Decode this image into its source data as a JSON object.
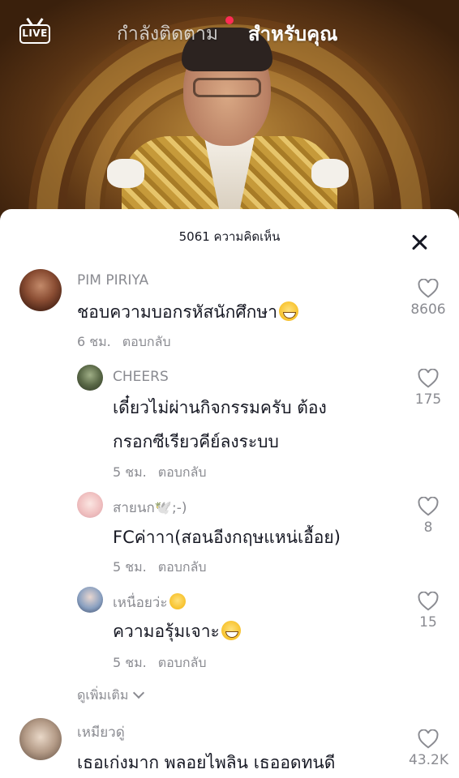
{
  "topbar": {
    "live_label": "LIVE",
    "tab_following": "กำลังติดตาม",
    "tab_for_you": "สำหรับคุณ"
  },
  "sheet": {
    "comment_count": "5061 ความคิดเห็น"
  },
  "comments": [
    {
      "username": "PIM PIRIYA",
      "text": "ชอบความบอกรหัสนักศึกษา",
      "time": "6 ชม.",
      "reply": "ตอบกลับ",
      "likes": "8606"
    },
    {
      "username": "CHEERS",
      "text_line1": "เดี๋ยวไม่ผ่านกิจกรรมครับ ต้อง",
      "text_line2": "กรอกซีเรียวคีย์ลงระบบ",
      "time": "5 ชม.",
      "reply": "ตอบกลับ",
      "likes": "175"
    },
    {
      "username": "สายนก🕊️;-)",
      "text": "FCค่าาา(สอนอีงกฤษแหน่เอื้อย)",
      "time": "5 ชม.",
      "reply": "ตอบกลับ",
      "likes": "8"
    },
    {
      "username": "เหนื่อยว่ะ",
      "text": "ความอรุ้มเจาะ",
      "time": "5 ชม.",
      "reply": "ตอบกลับ",
      "likes": "15"
    },
    {
      "username": "เหมียวดู่",
      "text": "เธอเก่งมาก พลอยไพลิน เธออดทนดี",
      "likes": "43.2K"
    }
  ],
  "see_more": "ดูเพิ่มเติม",
  "icons": {
    "live": "live-tv-icon",
    "close": "close-icon",
    "like": "heart-outline-icon",
    "expand": "chevron-down-icon"
  },
  "colors": {
    "accent_red": "#fe2c55",
    "secondary_text": "#8a8b91",
    "primary_text": "#161823"
  }
}
